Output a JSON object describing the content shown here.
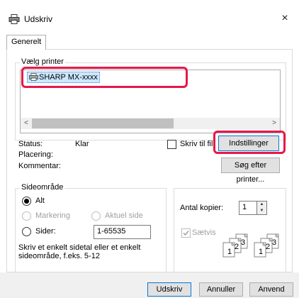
{
  "window": {
    "title": "Udskriv",
    "close_glyph": "×"
  },
  "tabs": [
    {
      "label": "Generelt",
      "selected": true
    }
  ],
  "printer_group": {
    "label": "Vælg printer",
    "items": [
      {
        "name": "SHARP MX-xxxx",
        "selected": true
      }
    ]
  },
  "status": {
    "status_label": "Status:",
    "status_value": "Klar",
    "location_label": "Placering:",
    "comment_label": "Kommentar:",
    "print_to_file_label": "Skriv til fil",
    "print_to_file_checked": false,
    "settings_button": "Indstillinger",
    "find_printer_button": "Søg efter printer..."
  },
  "page_range": {
    "label": "Sideområde",
    "all_label": "Alt",
    "selection_label": "Markering",
    "current_page_label": "Aktuel side",
    "pages_label": "Sider:",
    "pages_value": "1-65535",
    "help_text_line1": "Skriv et enkelt sidetal eller et enkelt",
    "help_text_line2": "sideområde, f.eks. 5-12",
    "selected": "all"
  },
  "copies": {
    "count_label": "Antal kopier:",
    "count_value": "1",
    "collate_label": "Sætvis",
    "collate_checked": true
  },
  "footer": {
    "print_button": "Udskriv",
    "cancel_button": "Annuller",
    "apply_button": "Anvend"
  },
  "colors": {
    "highlight": "#e8174a",
    "selection_bg": "#cce8ff",
    "focus_border": "#0078d7"
  }
}
